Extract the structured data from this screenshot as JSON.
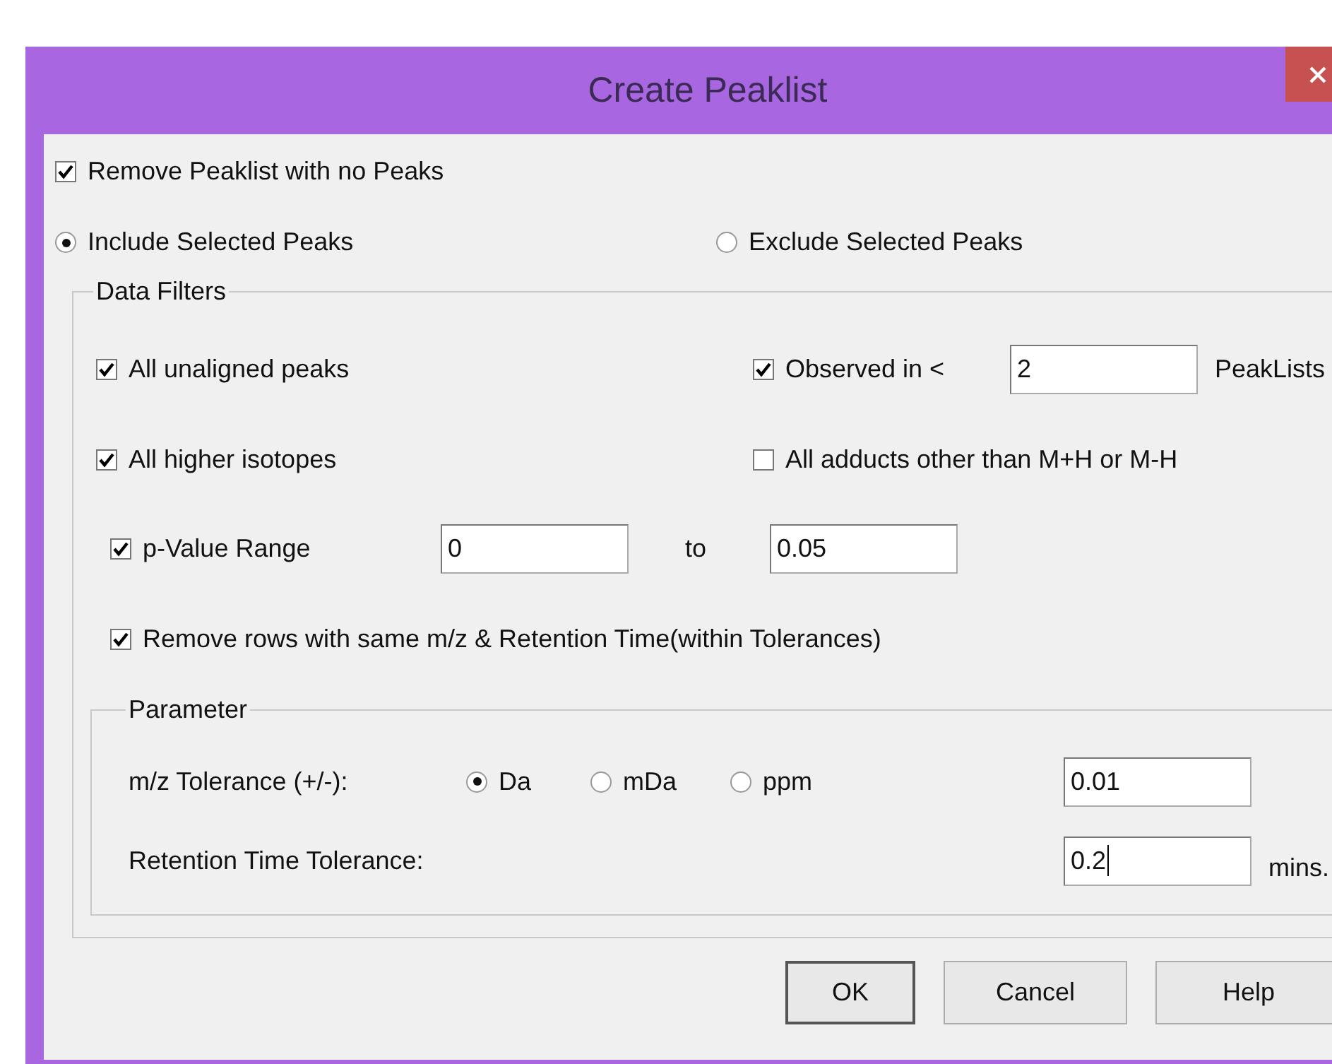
{
  "window": {
    "title": "Create Peaklist"
  },
  "remove_empty": {
    "label": "Remove Peaklist with no Peaks",
    "checked": true
  },
  "selection_mode": [
    {
      "label": "Include Selected Peaks",
      "selected": true
    },
    {
      "label": "Exclude Selected Peaks",
      "selected": false
    }
  ],
  "data_filters": {
    "title": "Data Filters",
    "unaligned": {
      "label": "All unaligned peaks",
      "checked": true
    },
    "observed": {
      "label": "Observed in <",
      "checked": true,
      "value": "2",
      "unit": "PeakLists"
    },
    "higher_isotopes": {
      "label": "All higher isotopes",
      "checked": true
    },
    "adducts": {
      "label": "All adducts other than M+H or M-H",
      "checked": false
    },
    "p_value": {
      "label": "p-Value Range",
      "checked": true,
      "from": "0",
      "to_label": "to",
      "to": "0.05"
    },
    "remove_duplicates": {
      "label": "Remove rows with same m/z & Retention Time(within Tolerances)",
      "checked": true
    },
    "parameter": {
      "title": "Parameter",
      "mz_label": "m/z Tolerance (+/-):",
      "mz_units": [
        {
          "label": "Da",
          "selected": true
        },
        {
          "label": "mDa",
          "selected": false
        },
        {
          "label": "ppm",
          "selected": false
        }
      ],
      "mz_value": "0.01",
      "rt_label": "Retention Time Tolerance:",
      "rt_value": "0.2",
      "rt_unit": "mins."
    }
  },
  "buttons": [
    {
      "label": "OK",
      "default": true
    },
    {
      "label": "Cancel",
      "default": false
    },
    {
      "label": "Help",
      "default": false
    }
  ]
}
